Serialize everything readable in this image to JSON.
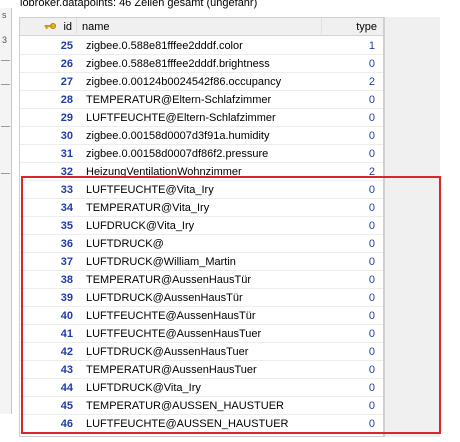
{
  "title": "iobroker.datapoints: 46 Zeilen gesamt (ungefähr)",
  "left_strip_chars": [
    "s",
    "3"
  ],
  "columns": {
    "id": "id",
    "name": "name",
    "type": "type"
  },
  "highlight_color": "#d9262b",
  "id_color": "#1f3ca8",
  "rows": [
    {
      "id": "25",
      "name": "zigbee.0.588e81fffee2dddf.color",
      "type": "1"
    },
    {
      "id": "26",
      "name": "zigbee.0.588e81fffee2dddf.brightness",
      "type": "0"
    },
    {
      "id": "27",
      "name": "zigbee.0.00124b0024542f86.occupancy",
      "type": "2"
    },
    {
      "id": "28",
      "name": "TEMPERATUR@Eltern-Schlafzimmer",
      "type": "0"
    },
    {
      "id": "29",
      "name": "LUFTFEUCHTE@Eltern-Schlafzimmer",
      "type": "0"
    },
    {
      "id": "30",
      "name": "zigbee.0.00158d0007d3f91a.humidity",
      "type": "0"
    },
    {
      "id": "31",
      "name": "zigbee.0.00158d0007df86f2.pressure",
      "type": "0"
    },
    {
      "id": "32",
      "name": "HeizungVentilationWohnzimmer",
      "type": "2"
    },
    {
      "id": "33",
      "name": "LUFTFEUCHTE@Vita_Iry",
      "type": "0"
    },
    {
      "id": "34",
      "name": "TEMPERATUR@Vita_Iry",
      "type": "0"
    },
    {
      "id": "35",
      "name": "LUFDRUCK@Vita_Iry",
      "type": "0"
    },
    {
      "id": "36",
      "name": "LUFTDRUCK@",
      "type": "0"
    },
    {
      "id": "37",
      "name": "LUFTDRUCK@William_Martin",
      "type": "0"
    },
    {
      "id": "38",
      "name": "TEMPERATUR@AussenHausTür",
      "type": "0"
    },
    {
      "id": "39",
      "name": "LUFTDRUCK@AussenHausTür",
      "type": "0"
    },
    {
      "id": "40",
      "name": "LUFTFEUCHTE@AussenHausTür",
      "type": "0"
    },
    {
      "id": "41",
      "name": "LUFTFEUCHTE@AussenHausTuer",
      "type": "0"
    },
    {
      "id": "42",
      "name": "LUFTDRUCK@AussenHausTuer",
      "type": "0"
    },
    {
      "id": "43",
      "name": "TEMPERATUR@AussenHausTuer",
      "type": "0"
    },
    {
      "id": "44",
      "name": "LUFTDRUCK@Vita_Iry",
      "type": "0"
    },
    {
      "id": "45",
      "name": "TEMPERATUR@AUSSEN_HAUSTUER",
      "type": "0"
    },
    {
      "id": "46",
      "name": "LUFTFEUCHTE@AUSSEN_HAUSTUER",
      "type": "0"
    }
  ]
}
